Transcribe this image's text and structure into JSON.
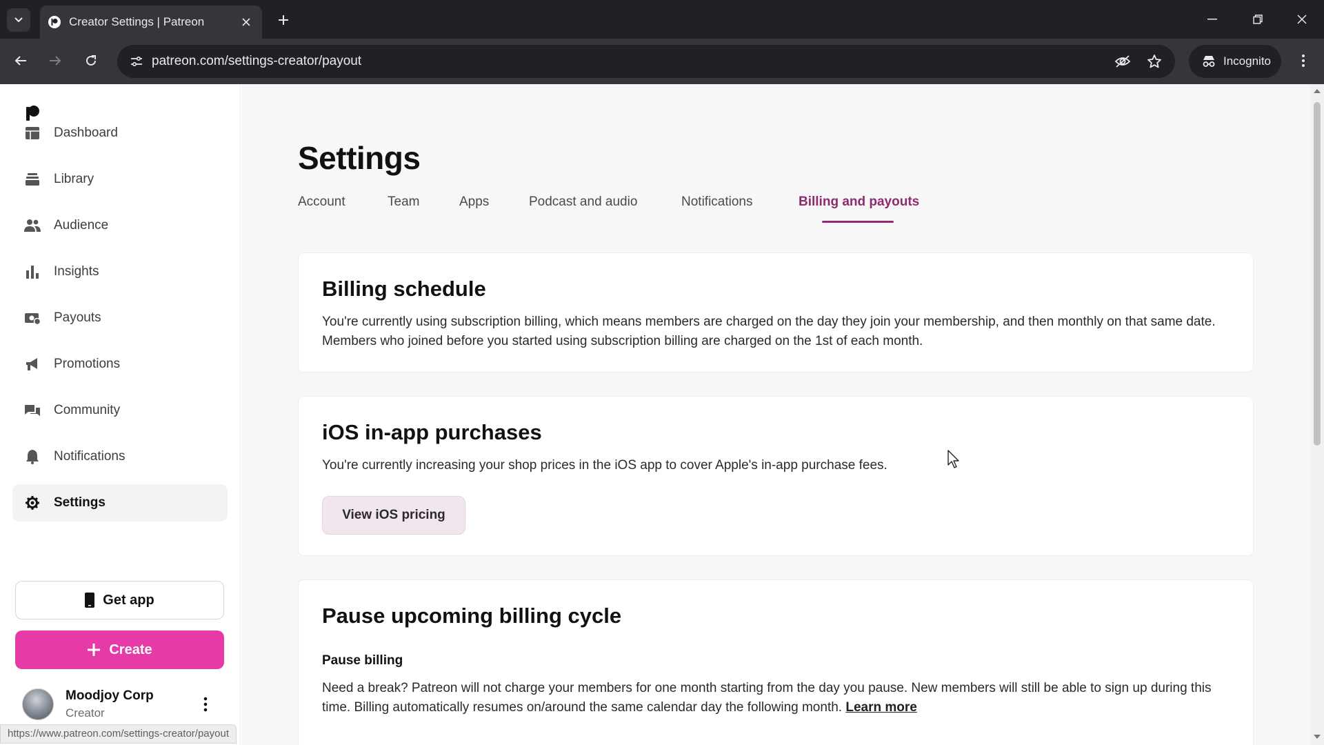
{
  "browser": {
    "tab_title": "Creator Settings | Patreon",
    "url": "patreon.com/settings-creator/payout",
    "incognito_label": "Incognito",
    "status_url": "https://www.patreon.com/settings-creator/payout"
  },
  "sidebar": {
    "items": [
      {
        "label": "Dashboard",
        "icon": "dashboard-icon"
      },
      {
        "label": "Library",
        "icon": "library-icon"
      },
      {
        "label": "Audience",
        "icon": "audience-icon"
      },
      {
        "label": "Insights",
        "icon": "insights-icon"
      },
      {
        "label": "Payouts",
        "icon": "payouts-icon"
      },
      {
        "label": "Promotions",
        "icon": "promotions-icon"
      },
      {
        "label": "Community",
        "icon": "community-icon"
      },
      {
        "label": "Notifications",
        "icon": "bell-icon"
      },
      {
        "label": "Settings",
        "icon": "gear-icon",
        "active": true
      }
    ],
    "get_app_label": "Get app",
    "create_label": "Create",
    "profile": {
      "name": "Moodjoy Corp",
      "role": "Creator"
    }
  },
  "main": {
    "title": "Settings",
    "tabs": [
      {
        "label": "Account"
      },
      {
        "label": "Team"
      },
      {
        "label": "Apps"
      },
      {
        "label": "Podcast and audio"
      },
      {
        "label": "Notifications"
      },
      {
        "label": "Billing and payouts",
        "active": true
      }
    ],
    "billing_schedule": {
      "title": "Billing schedule",
      "text": "You're currently using subscription billing, which means members are charged on the day they join your membership, and then monthly on that same date. Members who joined before you started using subscription billing are charged on the 1st of each month."
    },
    "ios": {
      "title": "iOS in-app purchases",
      "text": "You're currently increasing your shop prices in the iOS app to cover Apple's in-app purchase fees.",
      "button_label": "View iOS pricing"
    },
    "pause": {
      "title": "Pause upcoming billing cycle",
      "subtitle": "Pause billing",
      "text": "Need a break? Patreon will not charge your members for one month starting from the day you pause. New members will still be able to sign up during this time. Billing automatically resumes on/around the same calendar day the following month.",
      "link_label": "Learn more"
    }
  },
  "colors": {
    "accent": "#8e2a6f",
    "create_button": "#e63ba7",
    "page_background": "#f7f7f7"
  }
}
